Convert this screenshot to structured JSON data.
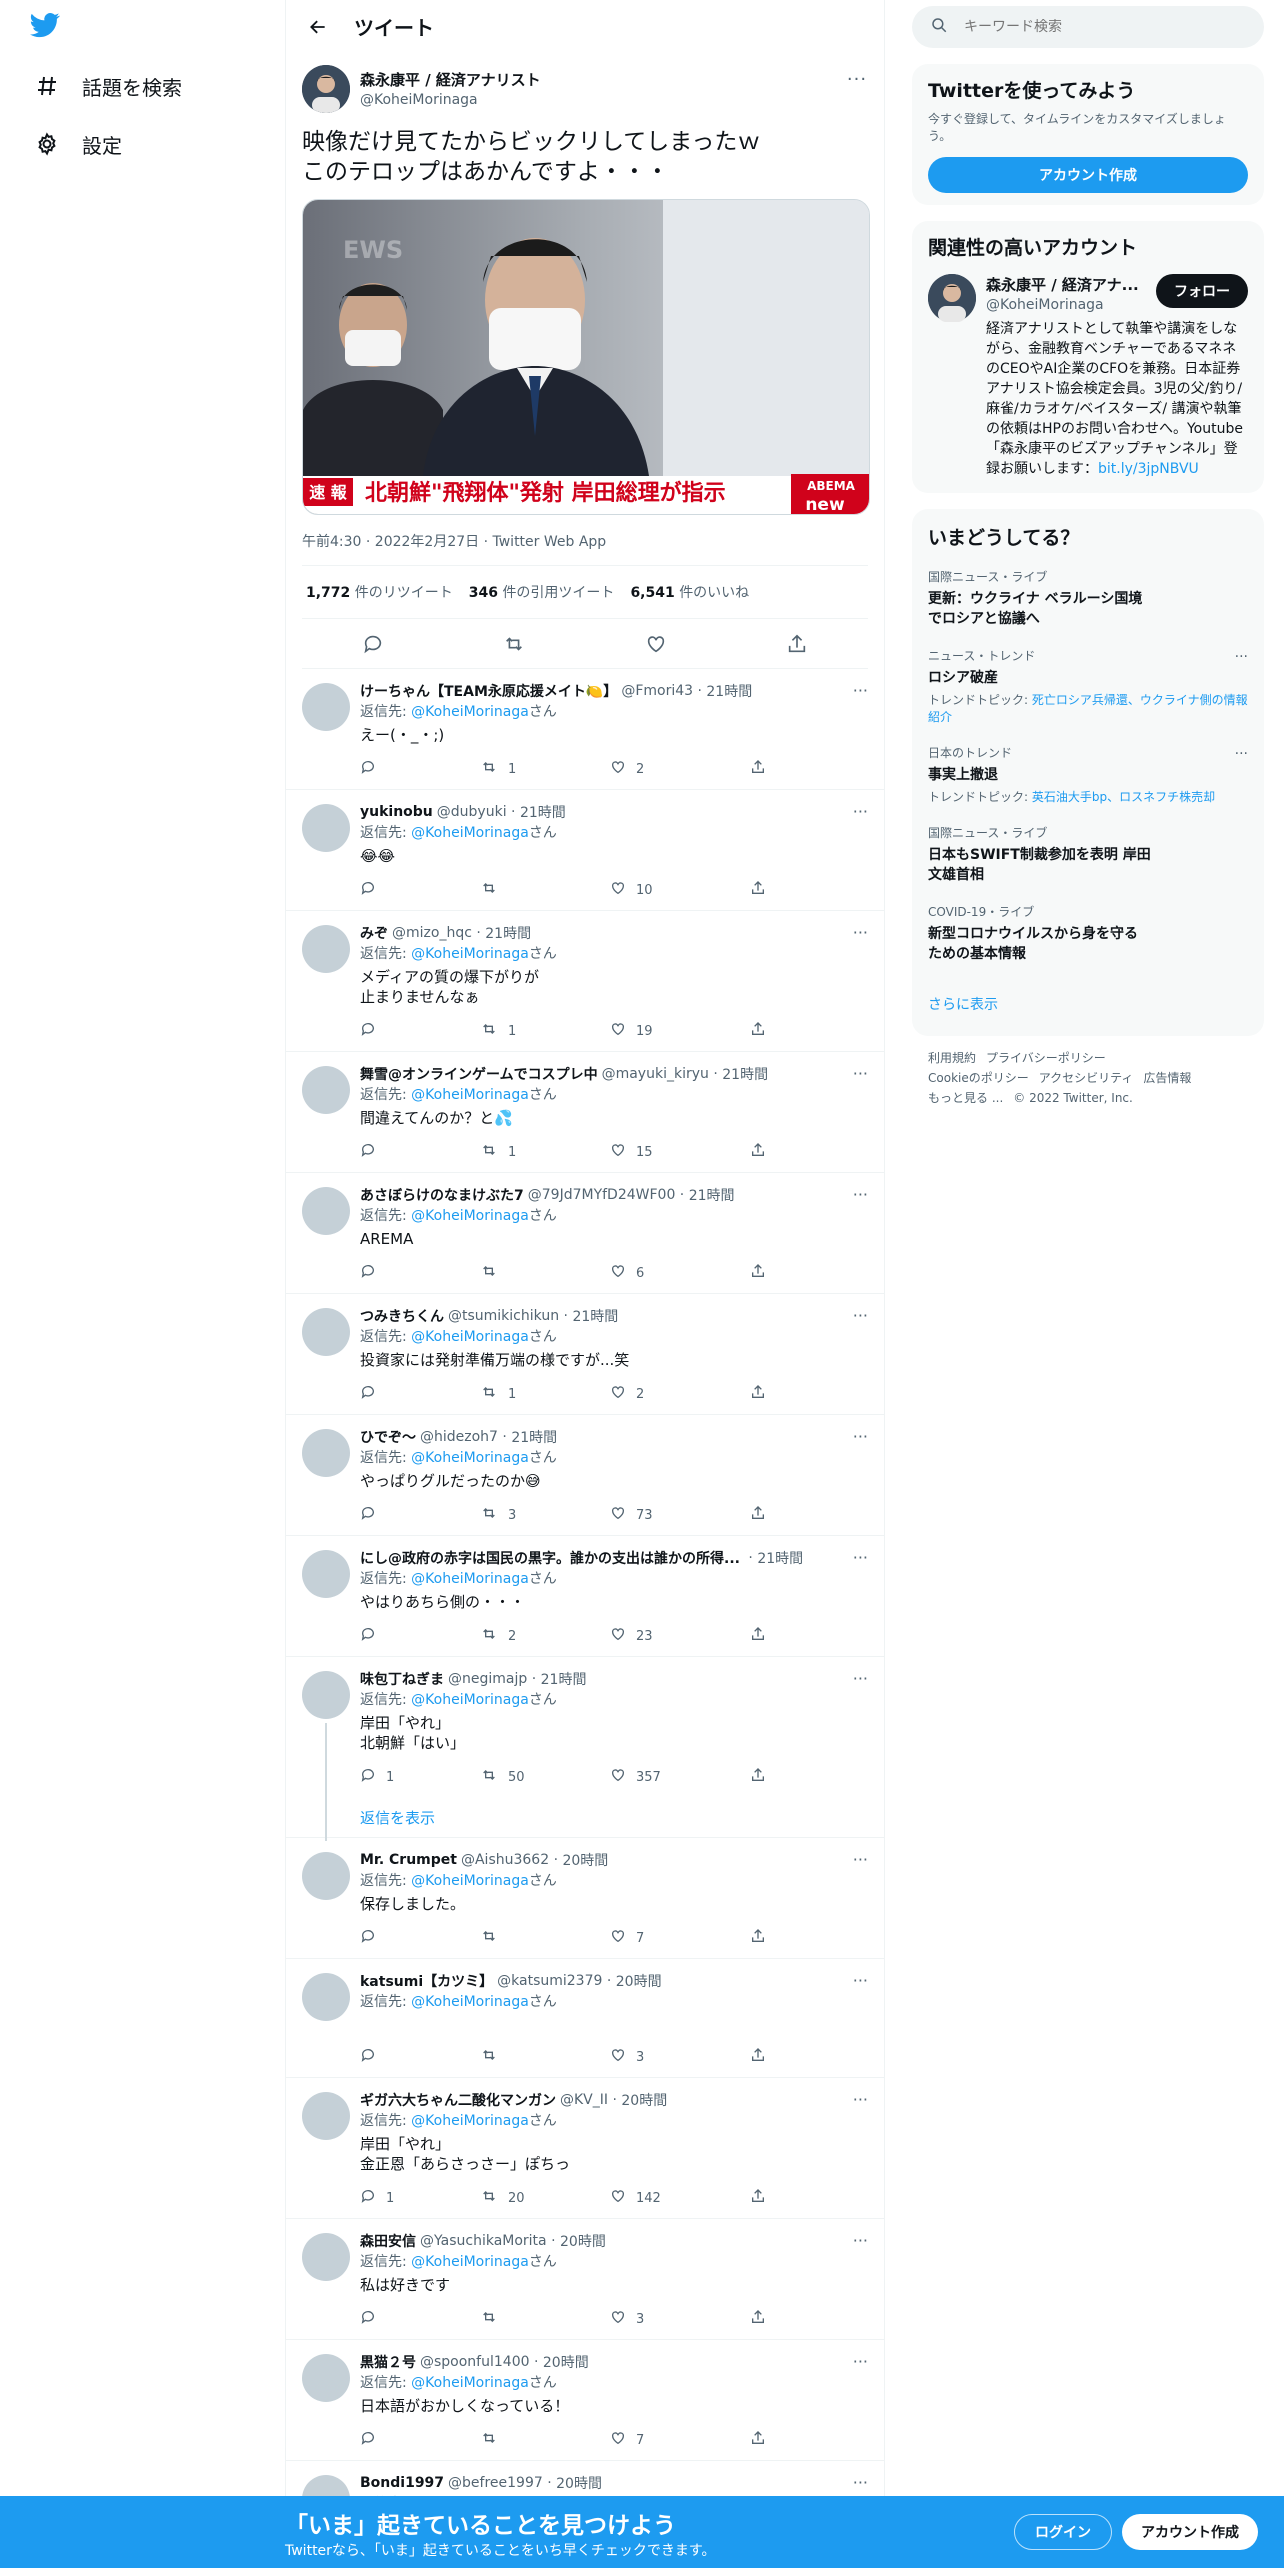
{
  "nav": {
    "items": [
      {
        "label": "話題を検索",
        "icon": "hashtag-icon"
      },
      {
        "label": "設定",
        "icon": "gear-icon"
      }
    ]
  },
  "header": {
    "title": "ツイート"
  },
  "tweet": {
    "author_name": "森永康平 / 経済アナリスト",
    "author_handle": "@KoheiMorinaga",
    "text": "映像だけ見てたからビックリしてしまったｗ\nこのテロップはあかんですよ・・・",
    "media": {
      "caption_flag": "速 報",
      "caption_text": "北朝鮮\"飛翔体\"発射 岸田総理が指示",
      "watermark": "EWS",
      "logo_top": "ABEMA",
      "logo_bottom": "new"
    },
    "meta": "午前4:30 · 2022年2月27日 · Twitter Web App",
    "retweets": "1,772",
    "retweets_label": "件のリツイート",
    "quotes": "346",
    "quotes_label": "件の引用ツイート",
    "likes": "6,541",
    "likes_label": "件のいいね"
  },
  "reply_to_label": "返信先: ",
  "reply_to_handle": "@KoheiMorinaga",
  "reply_to_suffix": "さん",
  "show_replies_label": "返信を表示",
  "replies": [
    {
      "name": "けーちゃん【TEAM永原応援メイト🍋】",
      "handle": "@Fmori43",
      "time": "21時間",
      "text": "えー(・_・;)",
      "replies": "",
      "retweets": "1",
      "likes": "2"
    },
    {
      "name": "yukinobu",
      "handle": "@dubyuki",
      "time": "21時間",
      "text": "😂😂",
      "replies": "",
      "retweets": "",
      "likes": "10"
    },
    {
      "name": "みぞ",
      "handle": "@mizo_hqc",
      "time": "21時間",
      "text": "メディアの質の爆下がりが\n止まりませんなぁ",
      "replies": "",
      "retweets": "1",
      "likes": "19"
    },
    {
      "name": "舞雪@オンラインゲームでコスプレ中",
      "handle": "@mayuki_kiryu",
      "time": "21時間",
      "text": "間違えてんのか？と💦",
      "replies": "",
      "retweets": "1",
      "likes": "15"
    },
    {
      "name": "あさぼらけのなまけぶた7",
      "handle": "@79Jd7MYfD24WF00",
      "time": "21時間",
      "text": "AREMA",
      "replies": "",
      "retweets": "",
      "likes": "6"
    },
    {
      "name": "つみきちくん",
      "handle": "@tsumikichikun",
      "time": "21時間",
      "text": "投資家には発射準備万端の様ですが...笑",
      "replies": "",
      "retweets": "1",
      "likes": "2"
    },
    {
      "name": "ひでぞ〜",
      "handle": "@hidezoh7",
      "time": "21時間",
      "text": "やっぱりグルだったのか😅",
      "replies": "",
      "retweets": "3",
      "likes": "73"
    },
    {
      "name": "にし@政府の赤字は国民の黒字。誰かの支出は誰かの所得...",
      "handle": "",
      "time": "21時間",
      "text": "やはりあちら側の・・・",
      "replies": "",
      "retweets": "2",
      "likes": "23"
    },
    {
      "name": "味包丁ねぎま",
      "handle": "@negimajp",
      "time": "21時間",
      "text": "岸田「やれ」\n北朝鮮「はい」",
      "replies": "1",
      "retweets": "50",
      "likes": "357",
      "thread": true
    },
    {
      "name": "Mr. Crumpet",
      "handle": "@Aishu3662",
      "time": "20時間",
      "text": "保存しました。",
      "replies": "",
      "retweets": "",
      "likes": "7"
    },
    {
      "name": "katsumi【カツミ】",
      "handle": "@katsumi2379",
      "time": "20時間",
      "text": "",
      "replies": "",
      "retweets": "",
      "likes": "3"
    },
    {
      "name": "ギガ六大ちゃん二酸化マンガン",
      "handle": "@KV_II",
      "time": "20時間",
      "text": "岸田「やれ」\n金正恩「あらさっさー」ぽちっ",
      "replies": "1",
      "retweets": "20",
      "likes": "142"
    },
    {
      "name": "森田安信",
      "handle": "@YasuchikaMorita",
      "time": "20時間",
      "text": "私は好きです",
      "replies": "",
      "retweets": "",
      "likes": "3"
    },
    {
      "name": "黒猫２号",
      "handle": "@spoonful1400",
      "time": "20時間",
      "text": "日本語がおかしくなっている！",
      "replies": "",
      "retweets": "",
      "likes": "7"
    },
    {
      "name": "Bondi1997",
      "handle": "@befree1997",
      "time": "20時間",
      "text": "",
      "replies": "",
      "retweets": "",
      "likes": ""
    }
  ],
  "right": {
    "search_placeholder": "キーワード検索",
    "signup_card": {
      "title": "Twitterを使ってみよう",
      "sub": "今すぐ登録して、タイムラインをカスタマイズしましょう。",
      "button": "アカウント作成"
    },
    "related": {
      "title": "関連性の高いアカウント",
      "name": "森永康平 / 経済アナ...",
      "handle": "@KoheiMorinaga",
      "follow": "フォロー",
      "bio": "経済アナリストとして執筆や講演をしながら、金融教育ベンチャーであるマネネのCEOやAI企業のCFOを兼務。日本証券アナリスト協会検定会員。3児の父/釣り/麻雀/カラオケ/ベイスターズ/ 講演や執筆の依頼はHPのお問い合わせへ。Youtube「森永康平のビズアップチャンネル」登録お願いします：",
      "bio_link": "bit.ly/3jpNBVU"
    },
    "trends": {
      "title": "いまどうしてる？",
      "items": [
        {
          "context": "国際ニュース・ライブ",
          "title": "更新：ウクライナ ベラルーシ国境\nでロシアと協議へ",
          "topic_prefix": "",
          "topic": "",
          "more": false
        },
        {
          "context": "ニュース・トレンド",
          "title": "ロシア破産",
          "topic_prefix": "トレンドトピック: ",
          "topic": "死亡ロシア兵帰還、ウクライナ側の情報紹介",
          "more": true
        },
        {
          "context": "日本のトレンド",
          "title": "事実上撤退",
          "topic_prefix": "トレンドトピック: ",
          "topic": "英石油大手bp、ロスネフチ株売却",
          "more": true
        },
        {
          "context": "国際ニュース・ライブ",
          "title": "日本もSWIFT制裁参加を表明 岸田\n文雄首相",
          "topic_prefix": "",
          "topic": "",
          "more": false
        },
        {
          "context": "COVID-19・ライブ",
          "title": "新型コロナウイルスから身を守る\nための基本情報",
          "topic_prefix": "",
          "topic": "",
          "more": false
        }
      ],
      "show_more": "さらに表示"
    },
    "footer": {
      "links": [
        "利用規約",
        "プライバシーポリシー",
        "Cookieのポリシー",
        "アクセシビリティ",
        "広告情報",
        "もっと見る ..."
      ],
      "copyright": "© 2022 Twitter, Inc."
    }
  },
  "bottom_bar": {
    "title": "「いま」起きていることを見つけよう",
    "sub": "Twitterなら、「いま」起きていることをいち早くチェックできます。",
    "login": "ログイン",
    "signup": "アカウント作成"
  },
  "colors": {
    "accent": "#1d9bf0",
    "text": "#0f1419",
    "muted": "#536471",
    "caption_red": "#d0021b"
  }
}
